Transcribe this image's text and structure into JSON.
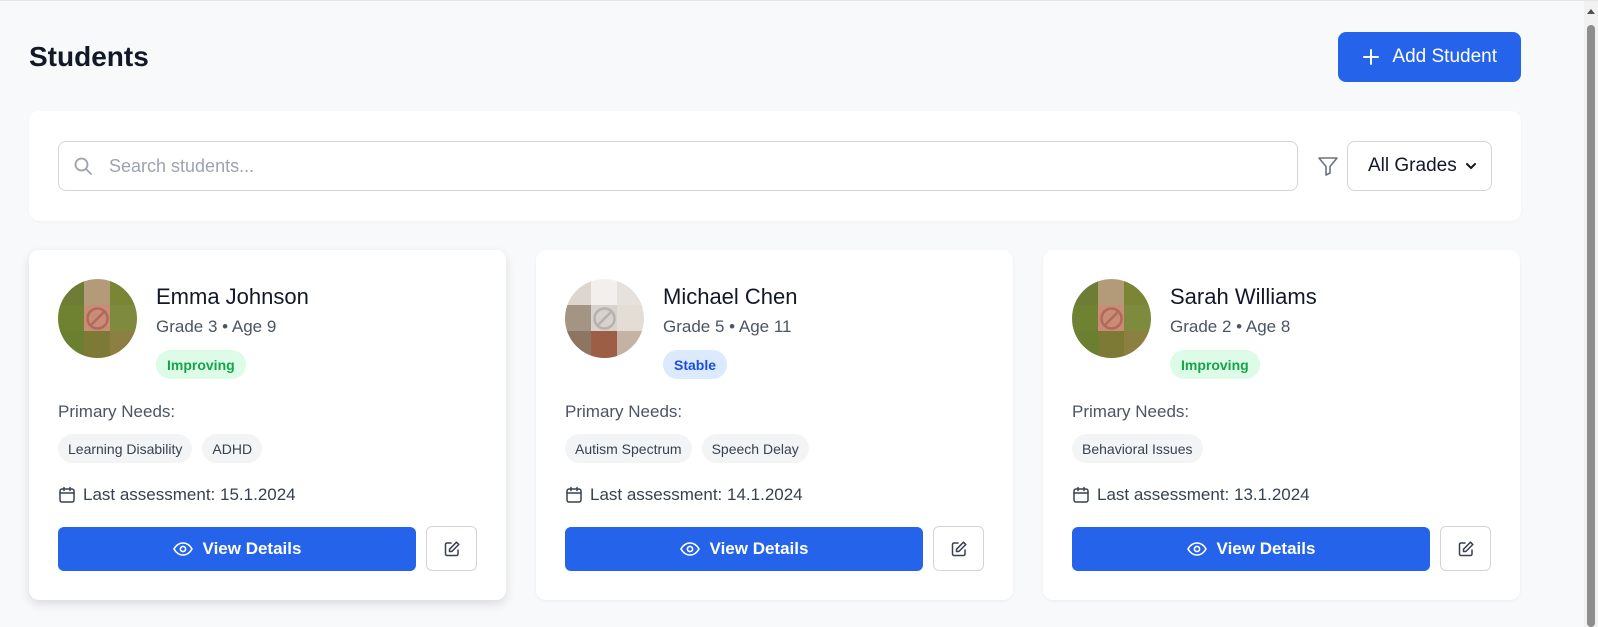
{
  "header": {
    "title": "Students",
    "add_button_label": "Add Student"
  },
  "filters": {
    "search_placeholder": "Search students...",
    "search_value": "",
    "grade_select_value": "All Grades"
  },
  "students": [
    {
      "name": "Emma Johnson",
      "meta": "Grade 3 • Age 9",
      "status": "Improving",
      "status_type": "improving",
      "needs_label": "Primary Needs:",
      "needs": [
        "Learning Disability",
        "ADHD"
      ],
      "assessment": "Last assessment: 15.1.2024",
      "view_label": "View Details"
    },
    {
      "name": "Michael Chen",
      "meta": "Grade 5 • Age 11",
      "status": "Stable",
      "status_type": "stable",
      "needs_label": "Primary Needs:",
      "needs": [
        "Autism Spectrum",
        "Speech Delay"
      ],
      "assessment": "Last assessment: 14.1.2024",
      "view_label": "View Details"
    },
    {
      "name": "Sarah Williams",
      "meta": "Grade 2 • Age 8",
      "status": "Improving",
      "status_type": "improving",
      "needs_label": "Primary Needs:",
      "needs": [
        "Behavioral Issues"
      ],
      "assessment": "Last assessment: 13.1.2024",
      "view_label": "View Details"
    }
  ],
  "colors": {
    "primary": "#2563eb",
    "improving_bg": "#dcfce7",
    "improving_text": "#16a34a",
    "stable_bg": "#dbeafe",
    "stable_text": "#1d4ed8"
  },
  "icons": {
    "add": "plus-icon",
    "search": "search-icon",
    "filter": "filter-icon",
    "select": "chevron-down-icon",
    "assessment": "calendar-icon",
    "view": "eye-icon",
    "edit": "edit-icon",
    "avatar": "broken-image-icon"
  }
}
